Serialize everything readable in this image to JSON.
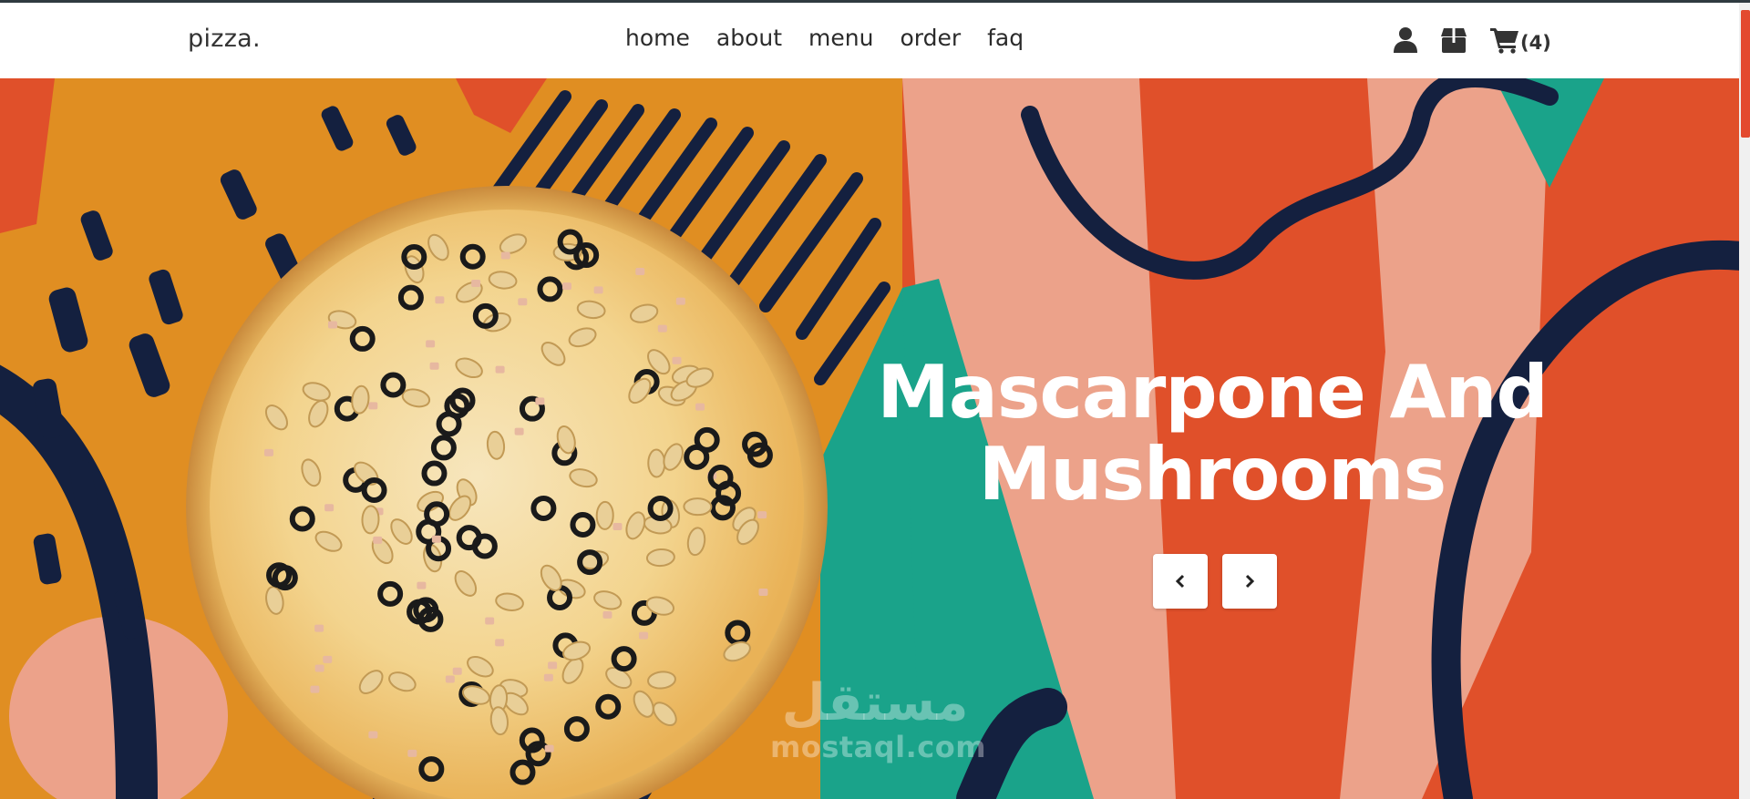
{
  "header": {
    "logo": "pizza.",
    "nav": [
      "home",
      "about",
      "menu",
      "order",
      "faq"
    ],
    "cart_count": "(4)",
    "icons": [
      "user-icon",
      "box-icon",
      "cart-icon"
    ]
  },
  "hero": {
    "title_line1": "Mascarpone And",
    "title_line2": "Mushrooms",
    "prev_icon": "chevron-left-icon",
    "next_icon": "chevron-right-icon"
  },
  "watermark": {
    "arabic": "مستقل",
    "latin": "mostaql.com"
  },
  "colors": {
    "accent": "#e34a2f",
    "mustard": "#e08e22",
    "navy": "#14203f",
    "teal": "#1aa38a",
    "salmon": "#eca28a",
    "orange_red": "#e0502a"
  }
}
